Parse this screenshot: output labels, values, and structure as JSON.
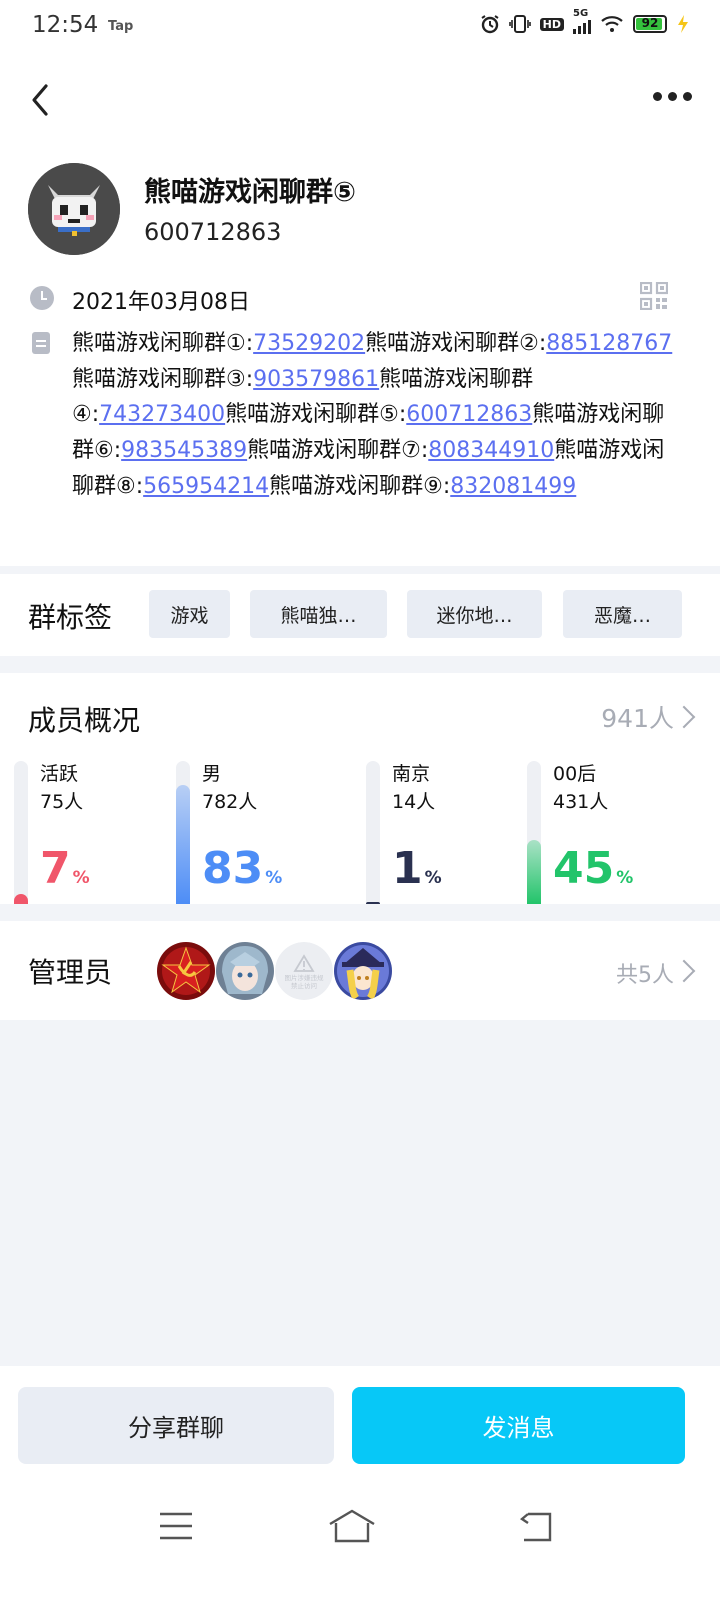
{
  "status_bar": {
    "time": "12:54",
    "app_indicator": "Tap",
    "network": "5G",
    "hd": "HD",
    "battery": "92",
    "battery_level": 0.92
  },
  "header": {
    "back_icon": "chevron-left-icon",
    "more_icon": "more-dots-icon"
  },
  "group": {
    "name": "熊喵游戏闲聊群⑤",
    "id": "600712863",
    "created_date": "2021年03月08日",
    "description": [
      {
        "text": "熊喵游戏闲聊群①:"
      },
      {
        "link": "73529202"
      },
      {
        "text": "熊喵游戏闲聊群②:"
      },
      {
        "link": "885128767"
      },
      {
        "text": "熊喵游戏闲聊群③:"
      },
      {
        "link": "903579861"
      },
      {
        "text": "熊喵游戏闲聊群④:"
      },
      {
        "link": "743273400"
      },
      {
        "text": "熊喵游戏闲聊群⑤:"
      },
      {
        "link": "600712863"
      },
      {
        "text": "熊喵游戏闲聊群⑥:"
      },
      {
        "link": "983545389"
      },
      {
        "text": "熊喵游戏闲聊群⑦:"
      },
      {
        "link": "808344910"
      },
      {
        "text": "熊喵游戏闲聊群⑧:"
      },
      {
        "link": "565954214"
      },
      {
        "text": "熊喵游戏闲聊群⑨:"
      },
      {
        "link": "832081499"
      }
    ]
  },
  "tags": {
    "title": "群标签",
    "items": [
      "游戏",
      "熊喵独…",
      "迷你地…",
      "恶魔…"
    ]
  },
  "members": {
    "title": "成员概况",
    "count": "941人",
    "stats": [
      {
        "label": "活跃",
        "count": "75人",
        "percent": "7",
        "percent_value": 7,
        "color": "#f0566a"
      },
      {
        "label": "男",
        "count": "782人",
        "percent": "83",
        "percent_value": 83,
        "color": "#4d8df6"
      },
      {
        "label": "南京",
        "count": "14人",
        "percent": "1",
        "percent_value": 1,
        "color": "#2a3150"
      },
      {
        "label": "00后",
        "count": "431人",
        "percent": "45",
        "percent_value": 45,
        "color": "#22c46a"
      }
    ],
    "percent_sign": "%"
  },
  "admins": {
    "title": "管理员",
    "count": "共5人",
    "avatars": [
      "red-star-avatar",
      "anime-girl-avatar",
      "placeholder-avatar",
      "witch-avatar"
    ],
    "placeholder_text": "图片涉嫌违规 禁止访问"
  },
  "actions": {
    "share_label": "分享群聊",
    "send_label": "发消息"
  },
  "nav": {
    "menu_icon": "menu-icon",
    "home_icon": "home-icon",
    "back_icon": "back-icon"
  }
}
